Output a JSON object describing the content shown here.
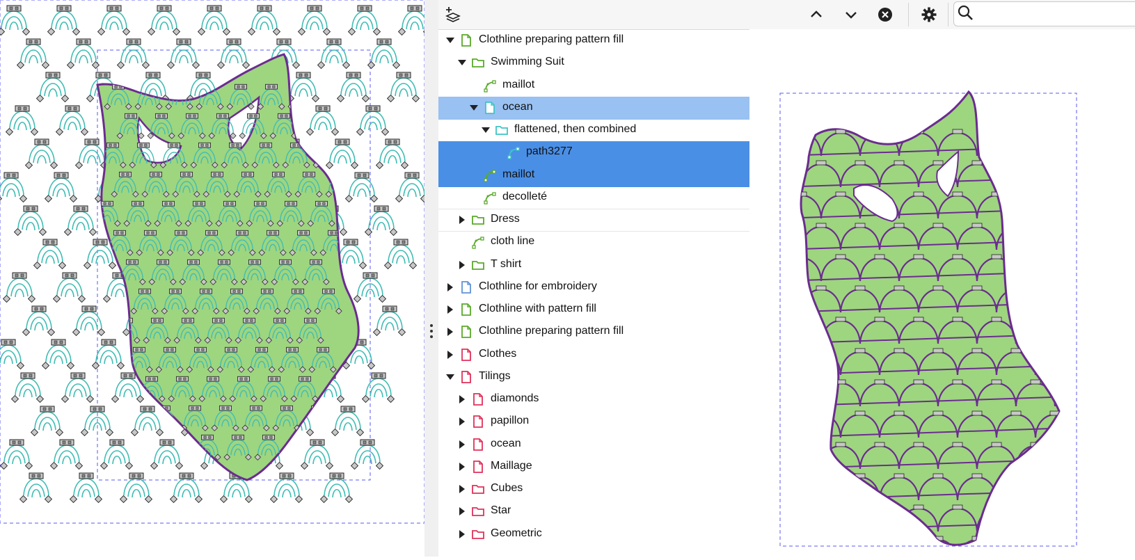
{
  "tree": {
    "rows": [
      {
        "label": "Clothline  preparing pattern fill",
        "icon": "document-icon",
        "color": "#5aaa2a",
        "state": "expanded"
      },
      {
        "label": "Swimming Suit",
        "icon": "folder-icon",
        "color": "#5aaa2a",
        "state": "expanded"
      },
      {
        "label": "maillot",
        "icon": "path-icon",
        "color": "#5aaa2a",
        "state": "none"
      },
      {
        "label": "ocean",
        "icon": "document-icon",
        "color": "#3ec4c4",
        "state": "expanded"
      },
      {
        "label": "flattened, then combined",
        "icon": "folder-icon",
        "color": "#3ec4c4",
        "state": "expanded"
      },
      {
        "label": "path3277",
        "icon": "path-icon",
        "color": "#3ec4c4",
        "state": "none"
      },
      {
        "label": "maillot",
        "icon": "path-icon",
        "color": "#5aaa2a",
        "state": "none"
      },
      {
        "label": "decolleté",
        "icon": "path-icon",
        "color": "#5aaa2a",
        "state": "none"
      },
      {
        "label": "Dress",
        "icon": "folder-icon",
        "color": "#5aaa2a",
        "state": "collapsed"
      },
      {
        "label": "cloth line",
        "icon": "path-icon",
        "color": "#5aaa2a",
        "state": "none"
      },
      {
        "label": "T shirt",
        "icon": "folder-icon",
        "color": "#5aaa2a",
        "state": "collapsed"
      },
      {
        "label": "Clothline for embroidery",
        "icon": "document-icon",
        "color": "#5f94d4",
        "state": "collapsed"
      },
      {
        "label": "Clothline  with pattern fill",
        "icon": "document-icon",
        "color": "#5aaa2a",
        "state": "collapsed"
      },
      {
        "label": "Clothline  preparing pattern fill",
        "icon": "document-icon",
        "color": "#5aaa2a",
        "state": "collapsed"
      },
      {
        "label": "Clothes",
        "icon": "document-icon",
        "color": "#e0315a",
        "state": "collapsed"
      },
      {
        "label": "Tilings",
        "icon": "document-icon",
        "color": "#e0315a",
        "state": "expanded"
      },
      {
        "label": "diamonds",
        "icon": "document-icon",
        "color": "#e0315a",
        "state": "collapsed"
      },
      {
        "label": "papillon",
        "icon": "document-icon",
        "color": "#e0315a",
        "state": "collapsed"
      },
      {
        "label": "ocean",
        "icon": "document-icon",
        "color": "#e0315a",
        "state": "collapsed"
      },
      {
        "label": "Maillage",
        "icon": "document-icon",
        "color": "#e0315a",
        "state": "collapsed"
      },
      {
        "label": "Cubes",
        "icon": "folder-icon",
        "color": "#e0315a",
        "state": "collapsed"
      },
      {
        "label": "Star",
        "icon": "folder-icon",
        "color": "#e0315a",
        "state": "collapsed"
      },
      {
        "label": "Geometric",
        "icon": "folder-icon",
        "color": "#e0315a",
        "state": "collapsed"
      }
    ]
  },
  "colors": {
    "selection_light": "#99c1f1",
    "selection_dark": "#4a8fe6",
    "fill_green": "#9ed57f",
    "outline_purple": "#6b2c8f",
    "pattern_teal": "#3fbdb4"
  },
  "toolbar": {
    "icons": [
      "add-layer-icon",
      "move-up-icon",
      "move-down-icon",
      "close-circle-icon",
      "gear-icon",
      "search-icon"
    ]
  }
}
